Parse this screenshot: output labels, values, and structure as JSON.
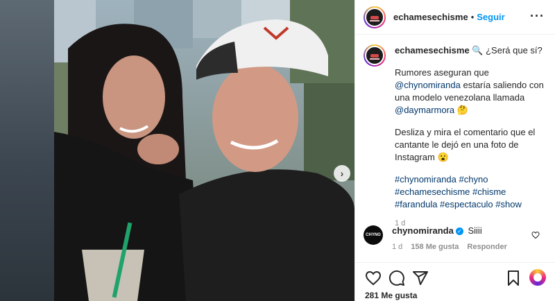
{
  "post": {
    "username": "echamesechisme",
    "separator": "•",
    "follow_label": "Seguir",
    "more_label": "···",
    "caption": {
      "username": "echamesechisme",
      "line1": "🔍 ¿Será que sí?",
      "p1_a": "Rumores aseguran que",
      "mention1": "@chynomiranda",
      "p1_b": "estaría saliendo con una modelo venezolana llamada",
      "mention2": "@daymarmora",
      "p1_emoji": "🤔",
      "p2": "Desliza y mira el comentario que el cantante le dejó en una foto de Instagram",
      "p2_emoji": "😮",
      "hashtags": "#chynomiranda #chyno #echamesechisme #chisme #farandula #espectaculo #show",
      "age": "1 d"
    },
    "comment": {
      "avatar_text": "CHYNO",
      "username": "chynomiranda",
      "verified": "✓",
      "text": "Siiii",
      "age": "1 d",
      "likes": "158 Me gusta",
      "reply": "Responder"
    },
    "like_count": "281 Me gusta",
    "next_label": "›"
  },
  "icons": [
    "heart-icon",
    "comment-icon",
    "share-icon",
    "bookmark-icon",
    "gift-icon",
    "chevron-right-icon"
  ],
  "colors": {
    "accent": "#0095f6",
    "link": "#00376b",
    "text": "#262626",
    "muted": "#8e8e8e"
  }
}
